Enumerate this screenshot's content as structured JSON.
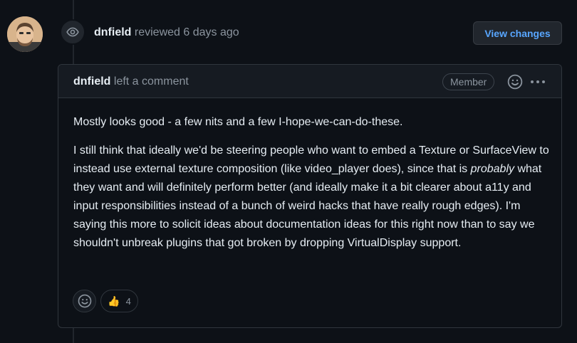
{
  "review": {
    "author": "dnfield",
    "action_text": "reviewed 6 days ago",
    "view_changes_label": "View changes"
  },
  "comment": {
    "author": "dnfield",
    "action_text": "left a comment",
    "role_badge": "Member",
    "paragraph1": "Mostly looks good - a few nits and a few I-hope-we-can-do-these.",
    "paragraph2_part1": "I still think that ideally we'd be steering people who want to embed a Texture or SurfaceView to instead use external texture composition (like video_player does), since that is ",
    "paragraph2_emphasis": "probably",
    "paragraph2_part2": " what they want and will definitely perform better (and ideally make it a bit clearer about a11y and input responsibilities instead of a bunch of weird hacks that have really rough edges). I'm saying this more to solicit ideas about documentation ideas for this right now than to say we shouldn't unbreak plugins that got broken by dropping VirtualDisplay support."
  },
  "reactions": {
    "thumbs_up_emoji": "👍",
    "thumbs_up_count": "4"
  },
  "icons": {
    "review_event": "eye-icon",
    "add_reaction": "smiley-icon",
    "more": "kebab-horizontal-icon"
  },
  "colors": {
    "background": "#0d1117",
    "link": "#58a6ff",
    "muted": "#8b949e",
    "border": "#30363d"
  }
}
